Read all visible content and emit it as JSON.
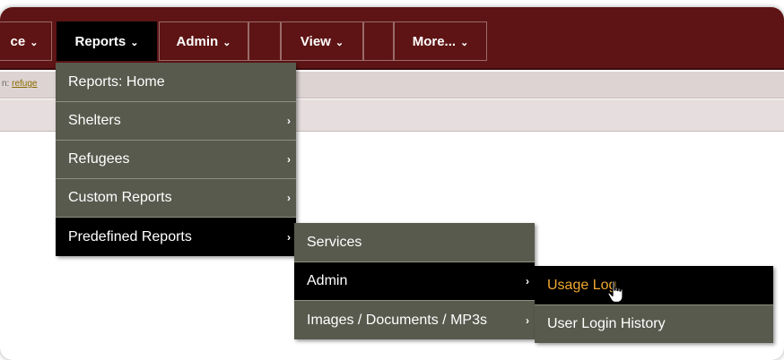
{
  "nav": {
    "items": [
      {
        "label": "ce",
        "active": false
      },
      {
        "label": "Reports",
        "active": true
      },
      {
        "label": "Admin",
        "active": false
      },
      {
        "label": "",
        "active": false
      },
      {
        "label": "View",
        "active": false
      },
      {
        "label": "",
        "active": false
      },
      {
        "label": "More...",
        "active": false
      }
    ]
  },
  "breadcrumb": {
    "prefix": "n: ",
    "link": "refuge"
  },
  "reports_menu": {
    "items": [
      {
        "label": "Reports: Home",
        "has_submenu": false
      },
      {
        "label": "Shelters",
        "has_submenu": true
      },
      {
        "label": "Refugees",
        "has_submenu": true
      },
      {
        "label": "Custom Reports",
        "has_submenu": true
      },
      {
        "label": "Predefined Reports",
        "has_submenu": true
      }
    ]
  },
  "predefined_menu": {
    "items": [
      {
        "label": "Services",
        "has_submenu": false
      },
      {
        "label": "Admin",
        "has_submenu": true
      },
      {
        "label": "Images / Documents / MP3s",
        "has_submenu": true
      }
    ]
  },
  "admin_menu": {
    "items": [
      {
        "label": "Usage Log",
        "highlighted": true
      },
      {
        "label": "User Login History",
        "highlighted": false
      }
    ]
  },
  "colors": {
    "topbar": "#5e1414",
    "menu_bg": "#575a4d",
    "active_bg": "#000000",
    "highlight_text": "#f0a830"
  },
  "icons": {
    "dropdown": "chevron-down-icon",
    "submenu": "chevron-right-icon",
    "cursor": "hand-pointer-icon"
  }
}
